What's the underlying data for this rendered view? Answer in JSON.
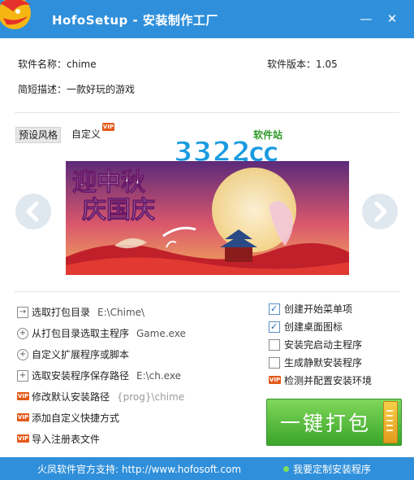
{
  "window": {
    "title": "HofoSetup - 安装制作工厂",
    "minimize_glyph": "—",
    "close_glyph": "✕"
  },
  "info": {
    "name_label": "软件名称：chime",
    "version_label": "软件版本：1.05",
    "desc_label": "简短描述：一款好玩的游戏"
  },
  "tabs": {
    "preset": "预设风格",
    "custom": "自定义",
    "vip_badge": "VIP"
  },
  "watermark": {
    "digits": "3322",
    "tld": ".CC",
    "caption": "软件站"
  },
  "banner": {
    "headline_1": "迎中秋",
    "headline_2": "庆国庆"
  },
  "options": [
    {
      "label": "选取打包目录",
      "value": "E:\\Chime\\"
    },
    {
      "label": "从打包目录选取主程序",
      "value": "Game.exe"
    },
    {
      "label": "自定义扩展程序或脚本",
      "value": ""
    },
    {
      "label": "选取安装程序保存路径",
      "value": "E:\\ch.exe"
    },
    {
      "label": "修改默认安装路径",
      "value": "{prog}\\chime"
    },
    {
      "label": "添加自定义快捷方式",
      "value": ""
    },
    {
      "label": "导入注册表文件",
      "value": ""
    }
  ],
  "checkboxes": [
    {
      "label": "创建开始菜单项",
      "checked": true
    },
    {
      "label": "创建桌面图标",
      "checked": true
    },
    {
      "label": "安装完启动主程序",
      "checked": false
    },
    {
      "label": "生成静默安装程序",
      "checked": false
    },
    {
      "label": "检测并配置安装环境",
      "vip": true
    }
  ],
  "pack_button": "一键打包",
  "footer": {
    "support": "火凤软件官方支持: http://www.hofosoft.com",
    "custom": "我要定制安装程序"
  },
  "colors": {
    "titlebar": "#2f8fda",
    "vip": "#e45a1a",
    "pack_green": "#3aa52a"
  }
}
